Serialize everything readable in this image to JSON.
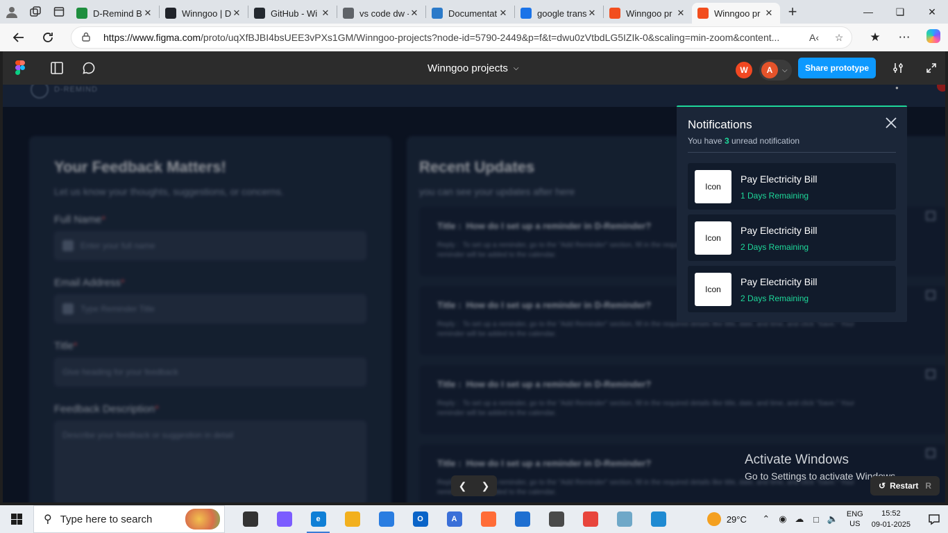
{
  "browser": {
    "tabs": [
      {
        "title": "D-Remind Bu",
        "favicon": "sheets-icon",
        "color": "#1e8e3e",
        "active": false
      },
      {
        "title": "Winngoo | D",
        "favicon": "react-icon",
        "color": "#20232a",
        "active": false
      },
      {
        "title": "GitHub - Wi",
        "favicon": "github-icon",
        "color": "#24292f",
        "active": false
      },
      {
        "title": "vs code dw -",
        "favicon": "search-icon",
        "color": "#5f6368",
        "active": false
      },
      {
        "title": "Documentat",
        "favicon": "vscode-icon",
        "color": "#2b7ac9",
        "active": false
      },
      {
        "title": "google trans",
        "favicon": "search-icon",
        "color": "#1a73e8",
        "active": false
      },
      {
        "title": "Winngoo pr",
        "favicon": "figma-icon",
        "color": "#f24e1e",
        "active": false
      },
      {
        "title": "Winngoo pr",
        "favicon": "figma-icon",
        "color": "#f24e1e",
        "active": true
      }
    ],
    "url_domain": "https://www.figma.com",
    "url_path": "/proto/uqXfBJBI4bsUEE3vPXs1GM/Winngoo-projects?node-id=5790-2449&p=f&t=dwu0zVtbdLG5IZIk-0&scaling=min-zoom&content..."
  },
  "figma": {
    "file_title": "Winngoo projects",
    "avatars": [
      {
        "initial": "W",
        "color": "#f24822"
      },
      {
        "initial": "A",
        "color": "#e5532a"
      }
    ],
    "share_label": "Share prototype",
    "accent": "#0d99ff"
  },
  "app_bg": {
    "logo_text": "D-REMIND",
    "feedback": {
      "heading": "Your Feedback Matters!",
      "subheading": "Let us know your thoughts, suggestions, or concerns.",
      "fields": [
        {
          "label": "Full Name",
          "placeholder": "Enter your full name"
        },
        {
          "label": "Email Address",
          "placeholder": "Type Reminder Title"
        },
        {
          "label": "Title",
          "placeholder": "Give heading for your feedback"
        }
      ],
      "description_label": "Feedback Description",
      "description_placeholder": "Describe your feedback or suggestion in detail"
    },
    "updates": {
      "heading": "Recent Updates",
      "subheading": "you can see your updates after here",
      "items": [
        {
          "title_label": "Title :",
          "title": "How do I set up a reminder in D-Reminder?",
          "reply_label": "Reply :",
          "reply": "To set up a reminder, go to the \"Add Reminder\" section, fill in the required details like title, date, and time, and click \"Save.\" Your reminder will be added to the calendar."
        },
        {
          "title_label": "Title :",
          "title": "How do I set up a reminder in D-Reminder?",
          "reply_label": "Reply :",
          "reply": "To set up a reminder, go to the \"Add Reminder\" section, fill in the required details like title, date, and time, and click \"Save.\" Your reminder will be added to the calendar."
        },
        {
          "title_label": "Title :",
          "title": "How do I set up a reminder in D-Reminder?",
          "reply_label": "Reply :",
          "reply": "To set up a reminder, go to the \"Add Reminder\" section, fill in the required details like title, date, and time, and click \"Save.\" Your reminder will be added to the calendar."
        },
        {
          "title_label": "Title :",
          "title": "How do I set up a reminder in D-Reminder?",
          "reply_label": "Reply :",
          "reply": "To set up a reminder, go to the \"Add Reminder\" section, fill in the required details like title, date, and time, and click \"Save.\" Your reminder will be added to the calendar."
        }
      ]
    }
  },
  "notifications": {
    "title": "Notifications",
    "sub_prefix": "You have",
    "unread_count": "3",
    "sub_suffix": "unread notification",
    "accent": "#1ed89a",
    "items": [
      {
        "icon_text": "Icon",
        "title": "Pay Electricity Bill",
        "remaining": "1 Days Remaining"
      },
      {
        "icon_text": "Icon",
        "title": "Pay Electricity Bill",
        "remaining": "2 Days Remaining"
      },
      {
        "icon_text": "Icon",
        "title": "Pay Electricity Bill",
        "remaining": "2 Days Remaining"
      }
    ]
  },
  "overlay": {
    "activate_title": "Activate Windows",
    "activate_sub": "Go to Settings to activate Windows.",
    "restart_label": "Restart",
    "restart_key": "R"
  },
  "taskbar": {
    "search_placeholder": "Type here to search",
    "weather": "29°C",
    "lang_top": "ENG",
    "lang_bottom": "US",
    "time": "15:52",
    "date": "09-01-2025",
    "apps": [
      {
        "name": "task-view-icon",
        "color": "#333333",
        "glyph": ""
      },
      {
        "name": "copilot-app-icon",
        "color": "#7b5cff",
        "glyph": ""
      },
      {
        "name": "edge-icon",
        "color": "#0f7fd6",
        "glyph": "e"
      },
      {
        "name": "file-explorer-icon",
        "color": "#f2b01e",
        "glyph": ""
      },
      {
        "name": "microsoft-store-icon",
        "color": "#2a7de1",
        "glyph": ""
      },
      {
        "name": "outlook-icon",
        "color": "#0a64c8",
        "glyph": "O"
      },
      {
        "name": "app-icon",
        "color": "#3a6fd8",
        "glyph": "A"
      },
      {
        "name": "postman-icon",
        "color": "#ff6c37",
        "glyph": ""
      },
      {
        "name": "app-icon-2",
        "color": "#1f6fd1",
        "glyph": ""
      },
      {
        "name": "calculator-icon",
        "color": "#4a4a4a",
        "glyph": ""
      },
      {
        "name": "chrome-icon",
        "color": "#e8453c",
        "glyph": ""
      },
      {
        "name": "notes-icon",
        "color": "#6fa8c8",
        "glyph": ""
      },
      {
        "name": "vscode-taskbar-icon",
        "color": "#1f8ad2",
        "glyph": ""
      }
    ]
  }
}
